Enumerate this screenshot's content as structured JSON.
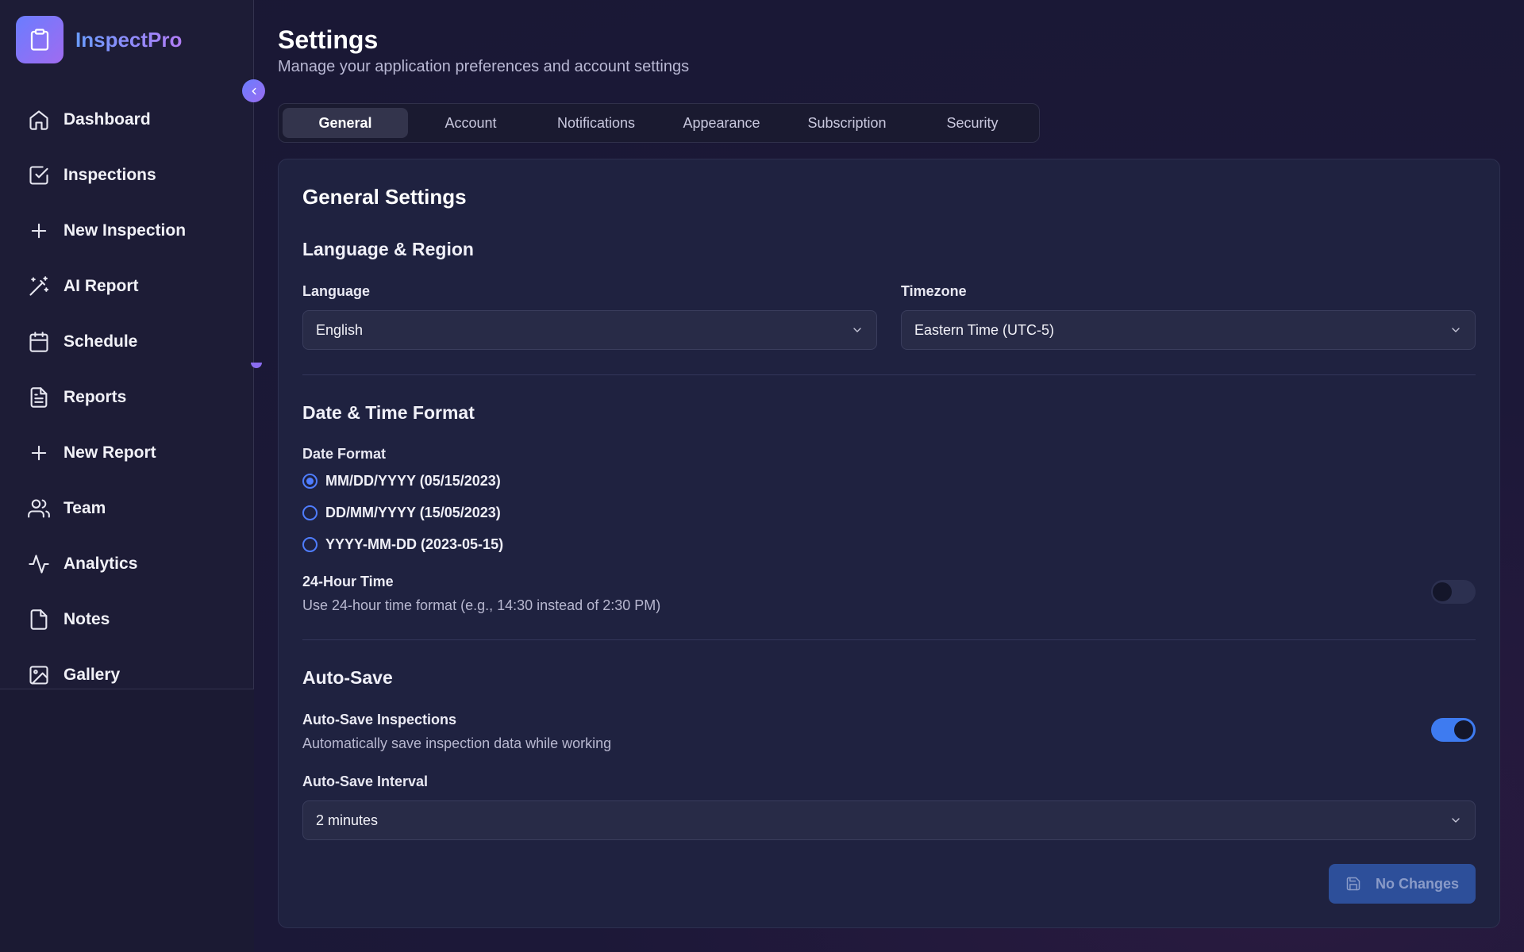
{
  "app": {
    "name": "InspectPro",
    "logo_icon": "clipboard-icon"
  },
  "sidebar": {
    "items": [
      {
        "label": "Dashboard",
        "icon": "home-icon"
      },
      {
        "label": "Inspections",
        "icon": "check-square-icon"
      },
      {
        "label": "New Inspection",
        "icon": "plus-icon"
      },
      {
        "label": "AI Report",
        "icon": "magic-wand-icon"
      },
      {
        "label": "Schedule",
        "icon": "calendar-icon"
      },
      {
        "label": "Reports",
        "icon": "file-text-icon"
      },
      {
        "label": "New Report",
        "icon": "plus-icon"
      },
      {
        "label": "Team",
        "icon": "users-icon"
      },
      {
        "label": "Analytics",
        "icon": "activity-icon"
      },
      {
        "label": "Notes",
        "icon": "file-icon"
      },
      {
        "label": "Gallery",
        "icon": "image-icon"
      }
    ]
  },
  "header": {
    "title": "Settings",
    "subtitle": "Manage your application preferences and account settings"
  },
  "tabs": [
    {
      "label": "General",
      "active": true
    },
    {
      "label": "Account",
      "active": false
    },
    {
      "label": "Notifications",
      "active": false
    },
    {
      "label": "Appearance",
      "active": false
    },
    {
      "label": "Subscription",
      "active": false
    },
    {
      "label": "Security",
      "active": false
    }
  ],
  "general": {
    "heading": "General Settings",
    "language_region": {
      "heading": "Language & Region",
      "language_label": "Language",
      "language_value": "English",
      "timezone_label": "Timezone",
      "timezone_value": "Eastern Time (UTC-5)"
    },
    "datetime": {
      "heading": "Date & Time Format",
      "date_format_label": "Date Format",
      "options": [
        {
          "label": "MM/DD/YYYY (05/15/2023)",
          "selected": true
        },
        {
          "label": "DD/MM/YYYY (15/05/2023)",
          "selected": false
        },
        {
          "label": "YYYY-MM-DD (2023-05-15)",
          "selected": false
        }
      ],
      "hour24_title": "24-Hour Time",
      "hour24_desc": "Use 24-hour time format (e.g., 14:30 instead of 2:30 PM)",
      "hour24_enabled": false
    },
    "autosave": {
      "heading": "Auto-Save",
      "title": "Auto-Save Inspections",
      "desc": "Automatically save inspection data while working",
      "enabled": true,
      "interval_label": "Auto-Save Interval",
      "interval_value": "2 minutes"
    },
    "save_button": {
      "label": "No Changes",
      "icon": "save-icon"
    }
  },
  "colors": {
    "accent": "#3e7bf0",
    "brand_gradient_start": "#6a7dff",
    "brand_gradient_end": "#a06bf0"
  }
}
